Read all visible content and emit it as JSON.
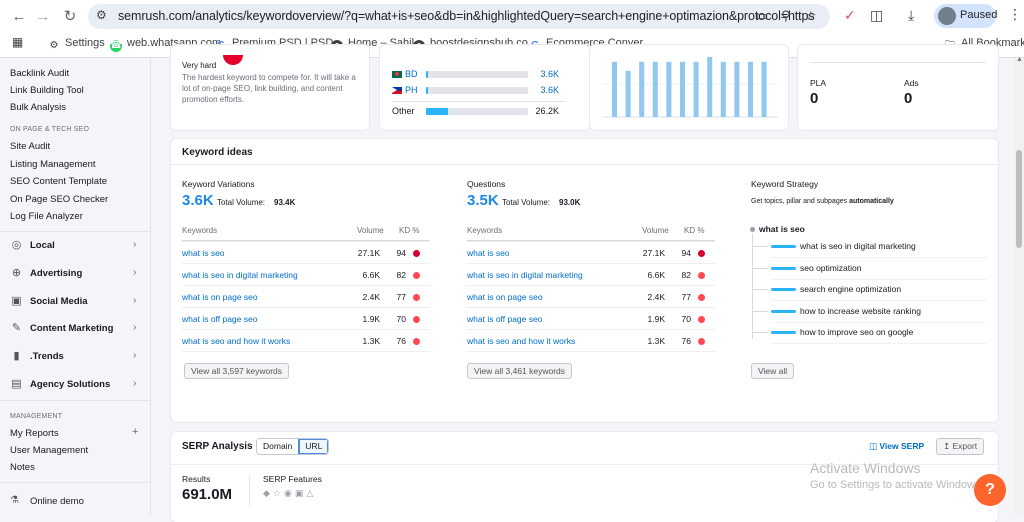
{
  "browser": {
    "url": "semrush.com/analytics/keywordoverview/?q=what+is+seo&db=in&highlightedQuery=search+engine+optimazion&protocol=https",
    "profile_label": "Paused",
    "bookmarks": [
      {
        "label": "Settings",
        "icon": "gear-icon"
      },
      {
        "label": "web.whatsapp.com",
        "icon": "whatsapp-icon"
      },
      {
        "label": "Premium PSD | PSD...",
        "icon": "google-icon"
      },
      {
        "label": "Home – Sahil",
        "icon": "globe-icon"
      },
      {
        "label": "boostdesignshub.co...",
        "icon": "globe-icon"
      },
      {
        "label": "Ecommerce Conver...",
        "icon": "google-icon"
      }
    ],
    "all_bookmarks": "All Bookmarks"
  },
  "sidebar": {
    "top_items": [
      "Backlink Audit",
      "Link Building Tool",
      "Bulk Analysis"
    ],
    "onpage_heading": "ON PAGE & TECH SEO",
    "onpage_items": [
      "Site Audit",
      "Listing Management",
      "SEO Content Template",
      "On Page SEO Checker",
      "Log File Analyzer"
    ],
    "main_items": [
      {
        "label": "Local",
        "icon": "location-icon"
      },
      {
        "label": "Advertising",
        "icon": "crosshair-icon"
      },
      {
        "label": "Social Media",
        "icon": "social-icon"
      },
      {
        "label": "Content Marketing",
        "icon": "pen-icon"
      },
      {
        "label": ".Trends",
        "icon": "bar-chart-icon"
      },
      {
        "label": "Agency Solutions",
        "icon": "document-icon"
      }
    ],
    "management_heading": "MANAGEMENT",
    "management_items": [
      "My Reports",
      "User Management",
      "Notes"
    ],
    "online_demo": "Online demo"
  },
  "difficulty_card": {
    "level": "Very hard",
    "description": "The hardest keyword to compete for. It will take a lot of on-page SEO, link building, and content promotion efforts."
  },
  "countries_card": {
    "rows": [
      {
        "code": "BD",
        "value": "3.6K",
        "share": 0.02
      },
      {
        "code": "PH",
        "value": "3.6K",
        "share": 0.02
      }
    ],
    "other": {
      "label": "Other",
      "value": "26.2K",
      "share": 0.22
    }
  },
  "trend_card": {
    "values": [
      0.92,
      0.77,
      0.92,
      0.92,
      0.92,
      0.92,
      0.92,
      1.0,
      0.92,
      0.92,
      0.92,
      0.92
    ]
  },
  "ads_card": {
    "pla_label": "PLA",
    "pla_value": "0",
    "ads_label": "Ads",
    "ads_value": "0"
  },
  "keyword_ideas": {
    "title": "Keyword ideas",
    "variations": {
      "title": "Keyword Variations",
      "count": "3.6K",
      "total_label": "Total Volume:",
      "total_value": "93.4K",
      "col_keywords": "Keywords",
      "col_volume": "Volume",
      "col_kd": "KD %",
      "rows": [
        {
          "keyword": "what is seo",
          "volume": "27.1K",
          "kd": "94",
          "color": "#d1002f"
        },
        {
          "keyword": "what is seo in digital marketing",
          "volume": "6.6K",
          "kd": "82",
          "color": "#ff4953"
        },
        {
          "keyword": "what is on page seo",
          "volume": "2.4K",
          "kd": "77",
          "color": "#ff4953"
        },
        {
          "keyword": "what is off page seo",
          "volume": "1.9K",
          "kd": "70",
          "color": "#ff4953"
        },
        {
          "keyword": "what is seo and how it works",
          "volume": "1.3K",
          "kd": "76",
          "color": "#ff4953"
        }
      ],
      "view_all": "View all 3,597 keywords"
    },
    "questions": {
      "title": "Questions",
      "count": "3.5K",
      "total_label": "Total Volume:",
      "total_value": "93.0K",
      "col_keywords": "Keywords",
      "col_volume": "Volume",
      "col_kd": "KD %",
      "rows": [
        {
          "keyword": "what is seo",
          "volume": "27.1K",
          "kd": "94",
          "color": "#d1002f"
        },
        {
          "keyword": "what is seo in digital marketing",
          "volume": "6.6K",
          "kd": "82",
          "color": "#ff4953"
        },
        {
          "keyword": "what is on page seo",
          "volume": "2.4K",
          "kd": "77",
          "color": "#ff4953"
        },
        {
          "keyword": "what is off page seo",
          "volume": "1.9K",
          "kd": "70",
          "color": "#ff4953"
        },
        {
          "keyword": "what is seo and how it works",
          "volume": "1.3K",
          "kd": "76",
          "color": "#ff4953"
        }
      ],
      "view_all": "View all 3,461 keywords"
    },
    "strategy": {
      "title": "Keyword Strategy",
      "subtitle_prefix": "Get topics, pillar and subpages ",
      "subtitle_bold": "automatically",
      "root": "what is seo",
      "items": [
        "what is seo in digital marketing",
        "seo optimization",
        "search engine optimization",
        "how to increase website ranking",
        "how to improve seo on google"
      ],
      "view_all": "View all"
    }
  },
  "serp": {
    "title": "SERP Analysis",
    "toggle": [
      "Domain",
      "URL"
    ],
    "active_toggle": "URL",
    "view_serp": "View SERP",
    "export": "Export",
    "results_label": "Results",
    "results_value": "691.0M",
    "features_label": "SERP Features"
  },
  "overlay": {
    "activate_title": "Activate Windows",
    "activate_sub": "Go to Settings to activate Windows",
    "help": "?"
  },
  "colors": {
    "accent": "#006dca",
    "bar": "#2bb3ff",
    "kd_very_hard": "#d1002f",
    "kd_hard": "#ff4953",
    "help": "#ff642d"
  }
}
